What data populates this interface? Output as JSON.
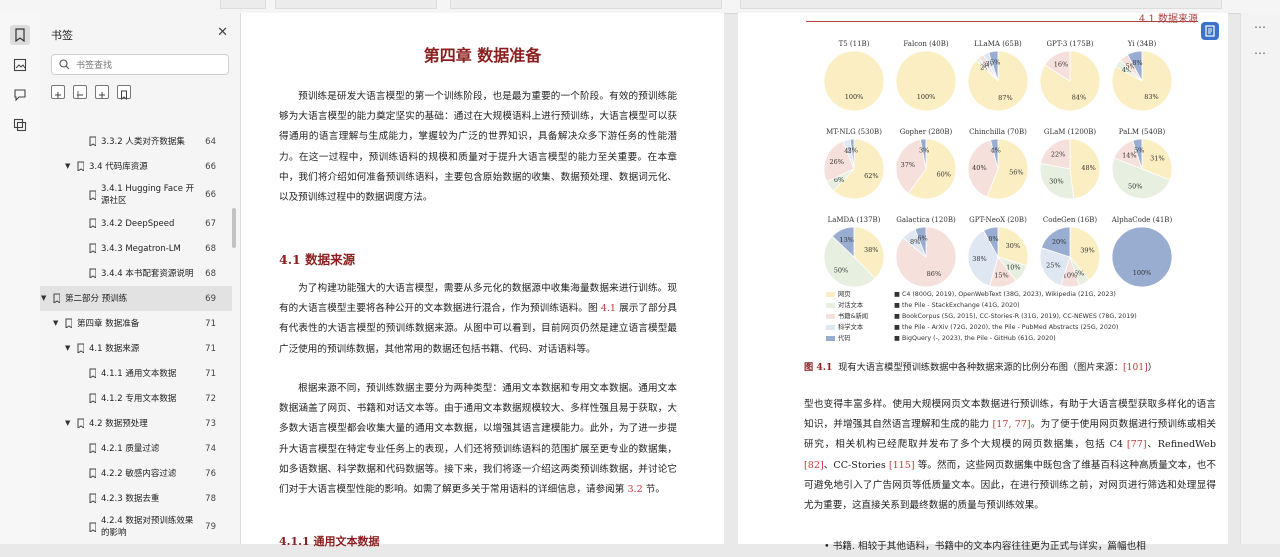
{
  "sidebar": {
    "title": "书签",
    "search_placeholder": "书签查找",
    "items": [
      {
        "label": "3.3.2 人类对齐数据集",
        "page": "64",
        "level": 3,
        "twisty": false
      },
      {
        "label": "3.4 代码库资源",
        "page": "66",
        "level": 2,
        "twisty": true
      },
      {
        "label": "3.4.1 Hugging Face 开",
        "label2": "源社区",
        "page": "66",
        "level": 3,
        "twisty": false
      },
      {
        "label": "3.4.2 DeepSpeed",
        "page": "67",
        "level": 3,
        "twisty": false
      },
      {
        "label": "3.4.3 Megatron-LM",
        "page": "68",
        "level": 3,
        "twisty": false
      },
      {
        "label": "3.4.4 本书配套资源说明",
        "page": "68",
        "level": 3,
        "twisty": false
      },
      {
        "label": "第二部分 预训练",
        "page": "69",
        "level": 0,
        "twisty": true,
        "selected": true
      },
      {
        "label": "第四章 数据准备",
        "page": "71",
        "level": 1,
        "twisty": true
      },
      {
        "label": "4.1 数据来源",
        "page": "71",
        "level": 2,
        "twisty": true
      },
      {
        "label": "4.1.1 通用文本数据",
        "page": "71",
        "level": 3,
        "twisty": false
      },
      {
        "label": "4.1.2 专用文本数据",
        "page": "72",
        "level": 3,
        "twisty": false
      },
      {
        "label": "4.2 数据预处理",
        "page": "73",
        "level": 2,
        "twisty": true
      },
      {
        "label": "4.2.1 质量过滤",
        "page": "74",
        "level": 3,
        "twisty": false
      },
      {
        "label": "4.2.2 敏感内容过滤",
        "page": "76",
        "level": 3,
        "twisty": false
      },
      {
        "label": "4.2.3 数据去重",
        "page": "78",
        "level": 3,
        "twisty": false
      },
      {
        "label": "4.2.4 数据对预训练效果",
        "label2": "的影响",
        "page": "79",
        "level": 3,
        "twisty": false
      }
    ]
  },
  "left_page": {
    "chapter_title": "第四章 数据准备",
    "intro": "预训练是研发大语言模型的第一个训练阶段，也是最为重要的一个阶段。有效的预训练能够为大语言模型的能力奠定坚实的基础：通过在大规模语料上进行预训练，大语言模型可以获得通用的语言理解与生成能力，掌握较为广泛的世界知识，具备解决众多下游任务的性能潜力。在这一过程中，预训练语料的规模和质量对于提升大语言模型的能力至关重要。在本章中，我们将介绍如何准备预训练语料，主要包含原始数据的收集、数据预处理、数据词元化、以及预训练过程中的数据调度方法。",
    "section_title": "4.1 数据来源",
    "p1_a": "为了构建功能强大的大语言模型，需要从多元化的数据源中收集海量数据来进行训练。现有的大语言模型主要将各种公开的文本数据进行混合，作为预训练语料。图 ",
    "p1_ref": "4.1",
    "p1_b": " 展示了部分具有代表性的大语言模型的预训练数据来源。从图中可以看到，目前网页仍然是建立语言模型最广泛使用的预训练数据，其他常用的数据还包括书籍、代码、对话语料等。",
    "p2_a": "根据来源不同，预训练数据主要分为两种类型：通用文本数据和专用文本数据。通用文本数据涵盖了网页、书籍和对话文本等。由于通用文本数据规模较大、多样性强且易于获取，大多数大语言模型都会收集大量的通用文本数据，以增强其语言建模能力。此外，为了进一步提升大语言模型在特定专业任务上的表现，人们还将预训练语料的范围扩展至更专业的数据集，如多语数据、科学数据和代码数据等。接下来，我们将逐一介绍这两类预训练数据，并讨论它们对于大语言模型性能的影响。如需了解更多关于常用语料的详细信息，请参阅第 ",
    "p2_ref": "3.2",
    "p2_b": " 节。",
    "subsection_title": "4.1.1 通用文本数据"
  },
  "right_page": {
    "running_head": "4.1 数据来源",
    "caption_label": "图 4.1",
    "caption_text": "现有大语言模型预训练数据中各种数据来源的比例分布图（图片来源：",
    "caption_ref": "[101]",
    "caption_end": "）",
    "p1_a": "型也变得丰富多样。使用大规模网页文本数据进行预训练，有助于大语言模型获取多样化的语言知识，并增强其自然语言理解和生成的能力 ",
    "p1_ref1": "[17, 77]",
    "p1_b": "。为了便于使用网页数据进行预训练或相关研究，相关机构已经爬取并发布了多个大规模的网页数据集，包括 C4 ",
    "p1_ref2": "[77]",
    "p1_c": "、RefinedWeb ",
    "p1_ref3": "[82]",
    "p1_d": "、CC-Stories ",
    "p1_ref4": "[115]",
    "p1_e": " 等。然而，这些网页数据集中既包含了维基百科这种高质量文本，也不可避免地引入了广告网页等低质量文本。因此，在进行预训练之前，对网页进行筛选和处理显得尤为重要，这直接关系到最终数据的质量与预训练效果。",
    "p2": "• 书籍. 相较于其他语料，书籍中的文本内容往往更为正式与详实，篇幅也相"
  },
  "chart_data": {
    "type": "pie",
    "title": "",
    "categories": [
      "网页",
      "对话文本",
      "书籍&新闻",
      "科学文本",
      "代码"
    ],
    "colors": {
      "webpages": "#fbeec2",
      "conversation": "#e7efe0",
      "books_news": "#f6e0dc",
      "scientific": "#dfe7f3",
      "code": "#99add0"
    },
    "pies": [
      {
        "name": "T5 (11B)",
        "slices": [
          100
        ],
        "labels": [
          "100%"
        ]
      },
      {
        "name": "Falcon (40B)",
        "slices": [
          100
        ],
        "labels": [
          "100%"
        ]
      },
      {
        "name": "LLaMA (65B)",
        "slices": [
          87,
          2,
          3,
          3,
          5
        ],
        "labels": [
          "87%",
          "2%",
          "3%",
          "3%",
          "5%"
        ]
      },
      {
        "name": "GPT-3 (175B)",
        "slices": [
          84,
          16
        ],
        "labels": [
          "84%",
          "16%"
        ]
      },
      {
        "name": "Yi (34B)",
        "slices": [
          83,
          4,
          5,
          8
        ],
        "labels": [
          "83%",
          "4%",
          "5%",
          "8%"
        ]
      },
      {
        "name": "MT-NLG (530B)",
        "slices": [
          62,
          6,
          26,
          4,
          2
        ],
        "labels": [
          "62%",
          "6%",
          "26%",
          "4%",
          "2%"
        ]
      },
      {
        "name": "Gopher (280B)",
        "slices": [
          60,
          37,
          3
        ],
        "labels": [
          "60%",
          "37%",
          "3%"
        ]
      },
      {
        "name": "Chinchilla (70B)",
        "slices": [
          56,
          40,
          4
        ],
        "labels": [
          "56%",
          "40%",
          "4%"
        ]
      },
      {
        "name": "GLaM (1200B)",
        "slices": [
          48,
          30,
          22
        ],
        "labels": [
          "48%",
          "30%",
          "22%"
        ]
      },
      {
        "name": "PaLM (540B)",
        "slices": [
          31,
          50,
          14,
          5
        ],
        "labels": [
          "31%",
          "50%",
          "14%",
          "5%"
        ]
      },
      {
        "name": "LaMDA (137B)",
        "slices": [
          38,
          50,
          13
        ],
        "labels": [
          "38%",
          "50%",
          "13%"
        ]
      },
      {
        "name": "Galactica (120B)",
        "slices": [
          86,
          8,
          6
        ],
        "labels": [
          "86%",
          "8%",
          "6%"
        ]
      },
      {
        "name": "GPT-NeoX (20B)",
        "slices": [
          30,
          10,
          15,
          38,
          8
        ],
        "labels": [
          "30%",
          "10%",
          "15%",
          "38%",
          "8%"
        ]
      },
      {
        "name": "CodeGen (16B)",
        "slices": [
          39,
          6,
          10,
          25,
          20
        ],
        "labels": [
          "39%",
          "6%",
          "10%",
          "25%",
          "20%"
        ]
      },
      {
        "name": "AlphaCode (41B)",
        "slices": [
          100
        ],
        "labels": [
          "100%"
        ]
      }
    ],
    "legend": [
      {
        "label": "网页",
        "sources": "C4 (800G, 2019), OpenWebText (38G, 2023), Wikipedia (21G, 2023)"
      },
      {
        "label": "对话文本",
        "sources": "the Pile - StackExchange (41G, 2020)"
      },
      {
        "label": "书籍&新闻",
        "sources": "BookCorpus (5G, 2015), CC-Stories-R (31G, 2019), CC-NEWES (78G, 2019)"
      },
      {
        "label": "科学文本",
        "sources": "the Pile - ArXiv (72G, 2020), the Pile - PubMed Abstracts (25G, 2020)"
      },
      {
        "label": "代码",
        "sources": "BigQuery (-, 2023), the Pile - GitHub (61G, 2020)"
      }
    ]
  }
}
